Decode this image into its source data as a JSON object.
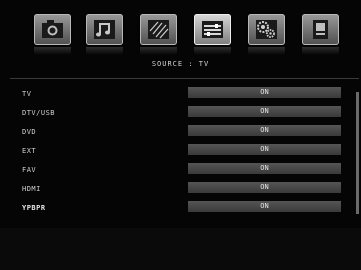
{
  "menu": {
    "icons": [
      {
        "icon": "picture-icon",
        "active": false
      },
      {
        "icon": "sound-icon",
        "active": false
      },
      {
        "icon": "channel-icon",
        "active": false
      },
      {
        "icon": "source-icon",
        "active": true
      },
      {
        "icon": "setup-icon",
        "active": false
      },
      {
        "icon": "lock-icon",
        "active": false
      }
    ]
  },
  "caption": "SOURCE : TV",
  "sources": [
    {
      "label": "TV",
      "value": "ON"
    },
    {
      "label": "DTV/USB",
      "value": "ON"
    },
    {
      "label": "DVD",
      "value": "ON"
    },
    {
      "label": "EXT",
      "value": "ON"
    },
    {
      "label": "FAV",
      "value": "ON"
    },
    {
      "label": "HDMI",
      "value": "ON"
    },
    {
      "label": "YPBPR",
      "value": "ON"
    }
  ]
}
